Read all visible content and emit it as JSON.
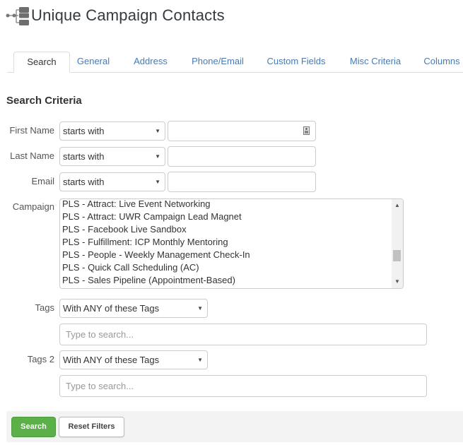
{
  "page": {
    "title": "Unique Campaign Contacts",
    "title_icon": "hierarchy-tree-icon"
  },
  "tabs": [
    {
      "label": "Search",
      "active": true
    },
    {
      "label": "General",
      "active": false
    },
    {
      "label": "Address",
      "active": false
    },
    {
      "label": "Phone/Email",
      "active": false
    },
    {
      "label": "Custom Fields",
      "active": false
    },
    {
      "label": "Misc Criteria",
      "active": false
    },
    {
      "label": "Columns",
      "active": false
    }
  ],
  "search_criteria": {
    "heading": "Search Criteria",
    "first_name": {
      "label": "First Name",
      "operator": "starts with",
      "value": "",
      "icon": "contact-card-icon"
    },
    "last_name": {
      "label": "Last Name",
      "operator": "starts with",
      "value": ""
    },
    "email": {
      "label": "Email",
      "operator": "starts with",
      "value": ""
    },
    "campaign": {
      "label": "Campaign",
      "options": [
        "PLS - Attract: Live Event Networking",
        "PLS - Attract: UWR Campaign Lead Magnet",
        "PLS - Facebook Live Sandbox",
        "PLS - Fulfillment: ICP Monthly Mentoring",
        "PLS - People - Weekly Management Check-In",
        "PLS - Quick Call Scheduling (AC)",
        "PLS - Sales Pipeline (Appointment-Based)"
      ]
    },
    "tags": {
      "label": "Tags",
      "operator": "With ANY of these Tags",
      "placeholder": "Type to search..."
    },
    "tags2": {
      "label": "Tags 2",
      "operator": "With ANY of these Tags",
      "placeholder": "Type to search..."
    }
  },
  "buttons": {
    "search": "Search",
    "reset": "Reset Filters"
  },
  "colors": {
    "link_blue": "#4a7ab0",
    "search_green": "#5cb048",
    "footer_bg": "#f3f3f3"
  }
}
